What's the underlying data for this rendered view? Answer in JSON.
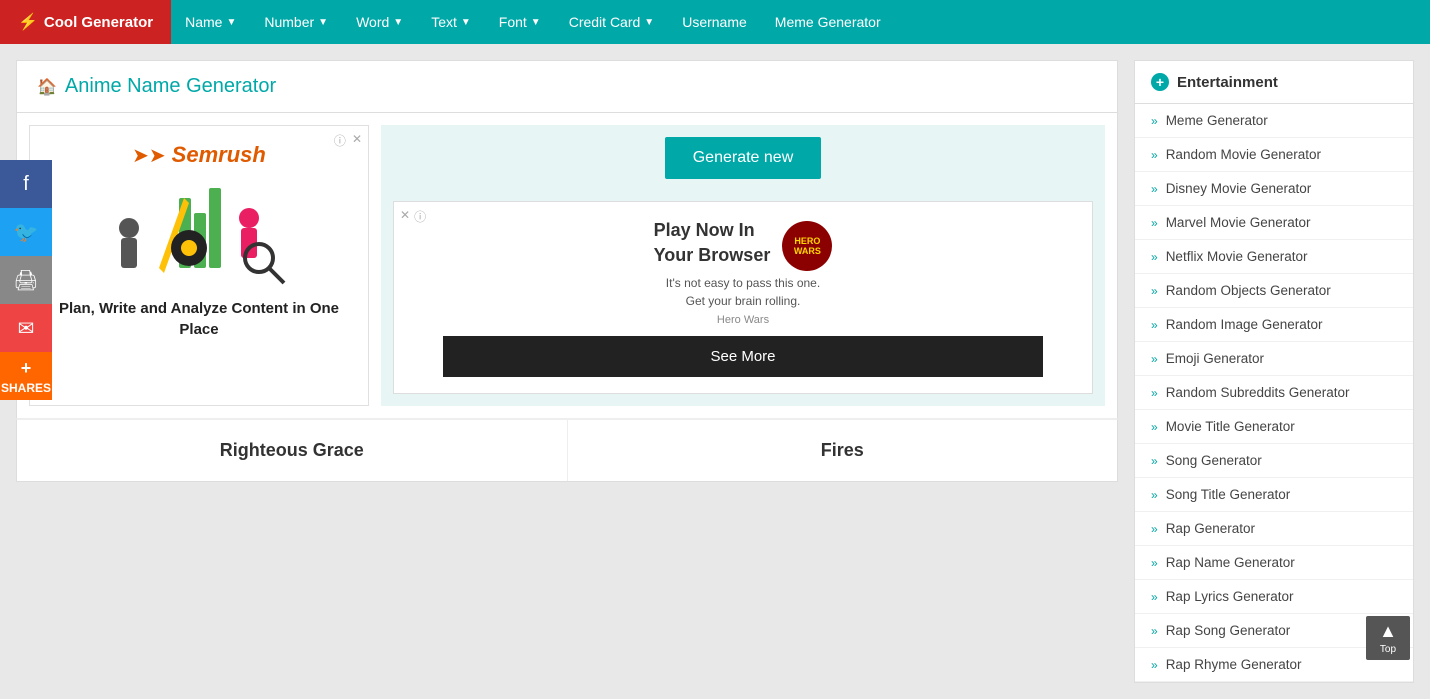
{
  "nav": {
    "brand": "Cool Generator",
    "items": [
      {
        "label": "Name",
        "hasDropdown": true
      },
      {
        "label": "Number",
        "hasDropdown": true
      },
      {
        "label": "Word",
        "hasDropdown": true
      },
      {
        "label": "Text",
        "hasDropdown": true
      },
      {
        "label": "Font",
        "hasDropdown": true
      },
      {
        "label": "Credit Card",
        "hasDropdown": true
      },
      {
        "label": "Username",
        "hasDropdown": false
      },
      {
        "label": "Meme Generator",
        "hasDropdown": false
      }
    ]
  },
  "page": {
    "title": "Anime Name Generator",
    "home_icon": "🏠"
  },
  "ad_left": {
    "company": "semrush",
    "tagline": "Plan, Write and Analyze Content in One Place"
  },
  "buttons": {
    "generate": "Generate new",
    "see_more": "See More"
  },
  "inner_ad": {
    "title_line1": "Play Now In",
    "title_line2": "Your Browser",
    "subtitle": "It's not easy to pass this one.\nGet your brain rolling.",
    "source": "Hero Wars"
  },
  "name_results": [
    {
      "name": "Righteous Grace"
    },
    {
      "name": "Fires"
    }
  ],
  "sidebar": {
    "section_title": "Entertainment",
    "items": [
      {
        "label": "Meme Generator"
      },
      {
        "label": "Random Movie Generator"
      },
      {
        "label": "Disney Movie Generator"
      },
      {
        "label": "Marvel Movie Generator"
      },
      {
        "label": "Netflix Movie Generator"
      },
      {
        "label": "Random Objects Generator"
      },
      {
        "label": "Random Image Generator"
      },
      {
        "label": "Emoji Generator"
      },
      {
        "label": "Random Subreddits Generator"
      },
      {
        "label": "Movie Title Generator"
      },
      {
        "label": "Song Generator"
      },
      {
        "label": "Song Title Generator"
      },
      {
        "label": "Rap Generator"
      },
      {
        "label": "Rap Name Generator"
      },
      {
        "label": "Rap Lyrics Generator"
      },
      {
        "label": "Rap Song Generator"
      },
      {
        "label": "Rap Rhyme Generator"
      }
    ]
  },
  "social": {
    "shares_label": "SHARES"
  },
  "scroll_top": {
    "label": "Top"
  }
}
